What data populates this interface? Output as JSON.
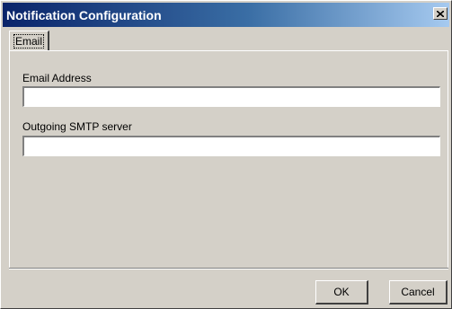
{
  "window": {
    "title": "Notification Configuration",
    "close_icon": "close-icon"
  },
  "tabs": [
    {
      "label": "Email",
      "selected": true
    }
  ],
  "form": {
    "email": {
      "label": "Email Address",
      "value": ""
    },
    "smtp": {
      "label": "Outgoing SMTP server",
      "value": ""
    }
  },
  "buttons": {
    "ok_label": "OK",
    "cancel_label": "Cancel"
  },
  "colors": {
    "titlebar_start": "#0a246a",
    "titlebar_end": "#a6caf0",
    "face": "#d4d0c8"
  }
}
